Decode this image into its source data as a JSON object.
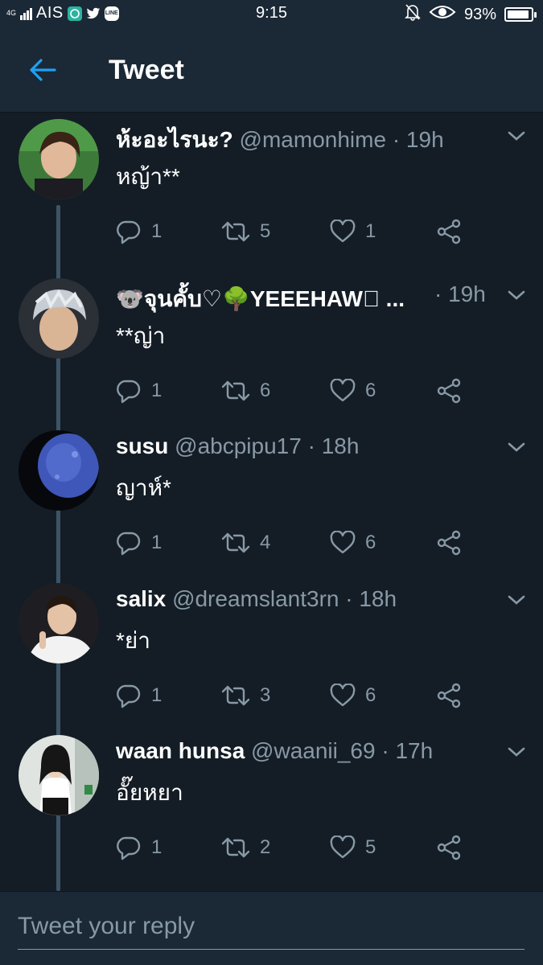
{
  "status_bar": {
    "network": "4G",
    "carrier": "AIS",
    "time": "9:15",
    "battery": "93%",
    "battery_level": 0.93,
    "app_icons": [
      "messenger-icon",
      "twitter-icon",
      "line-icon"
    ]
  },
  "header": {
    "title": "Tweet",
    "accent": "#1da1f2"
  },
  "tweets": [
    {
      "name": "ห้ะอะไรนะ?",
      "handle": "@mamonhime",
      "sep": " · ",
      "time": "19h",
      "text": "หญ้า**",
      "replies": "1",
      "retweets": "5",
      "likes": "1"
    },
    {
      "name": "🐨จุนคั้บ♡🌳YEEEHAW⃝ ...",
      "handle": "",
      "sep": "",
      "time": "· 19h",
      "text": "**ญ่า",
      "replies": "1",
      "retweets": "6",
      "likes": "6"
    },
    {
      "name": "susu",
      "handle": "@abcpipu17",
      "sep": " · ",
      "time": "18h",
      "text": "ญาห์*",
      "replies": "1",
      "retweets": "4",
      "likes": "6"
    },
    {
      "name": "salix",
      "handle": "@dreamslant3rn",
      "sep": " · ",
      "time": "18h",
      "text": "*ย่า",
      "replies": "1",
      "retweets": "3",
      "likes": "6"
    },
    {
      "name": "waan hunsa",
      "handle": "@waanii_69",
      "sep": " · ",
      "time": "17h",
      "text": "อั๊ยหยา",
      "replies": "1",
      "retweets": "2",
      "likes": "5"
    }
  ],
  "reply": {
    "placeholder": "Tweet your reply"
  },
  "colors": {
    "background": "#141d26",
    "bar": "#1b2836",
    "secondary_text": "#8899a6",
    "thread_line": "#3d5466"
  }
}
